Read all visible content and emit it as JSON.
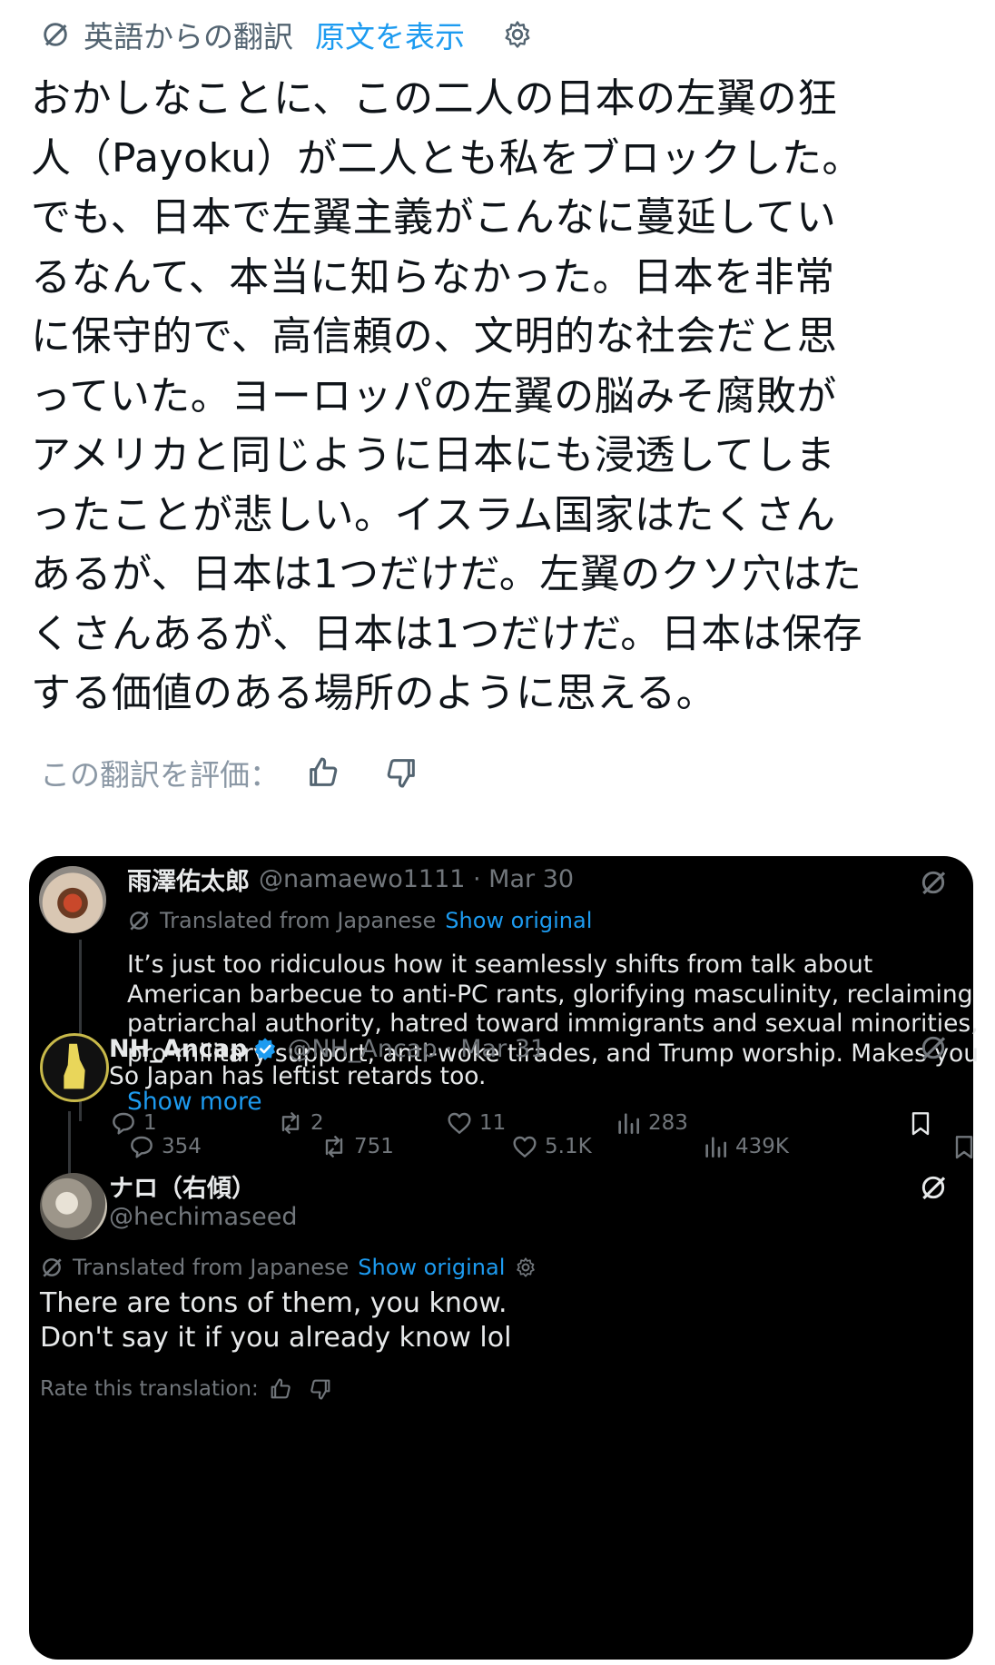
{
  "translation_bar": {
    "label": "英語からの翻訳",
    "show_original": "原文を表示"
  },
  "tweet_text": "おかしなことに、この二人の日本の左翼の狂\n人（Payoku）が二人とも私をブロックした。\nでも、日本で左翼主義がこんなに蔓延してい\nるなんて、本当に知らなかった。日本を非常\nに保守的で、高信頼の、文明的な社会だと思\nっていた。ヨーロッパの左翼の脳みそ腐敗が\nアメリカと同じように日本にも浸透してしま\nったことが悲しい。イスラム国家はたくさん\nあるが、日本は1つだけだ。左翼のクソ穴はた\nくさんあるが、日本は1つだけだ。日本は保存\nする価値のある場所のように思える。",
  "rate_translation": "この翻訳を評価：",
  "embedded": {
    "post1": {
      "name": "雨澤佑太郎",
      "handle_date": "@namaewo1111 · Mar 30",
      "translated_from": "Translated from Japanese",
      "show_original": "Show original",
      "text": "It’s just too ridiculous how it seamlessly shifts from talk about American barbecue to anti-PC rants, glorifying masculinity, reclaiming patriarchal authority, hatred toward immigrants and sexual minorities, pro-military support, anti-woke tirades, and Trump worship. Makes you",
      "show_more": "Show more",
      "replies": "354",
      "reposts": "751",
      "likes": "5.1K",
      "views": "439K"
    },
    "post2": {
      "name": "NH_Ancap",
      "handle_date": "@NH_Ancap · Mar 31",
      "text": "So Japan has leftist retards too.",
      "replies": "1",
      "reposts": "2",
      "likes": "11",
      "views": "283"
    },
    "post3": {
      "name": "ナロ（右傾）",
      "handle": "@hechimaseed",
      "translated_from": "Translated from Japanese",
      "show_original": "Show original",
      "line1": "There are tons of them, you know.",
      "line2": "Don't say it if you already know lol",
      "rate": "Rate this translation:"
    }
  },
  "colors": {
    "link_blue": "#1d9bf0",
    "dark_bg": "#000000",
    "muted": "#71767b"
  }
}
